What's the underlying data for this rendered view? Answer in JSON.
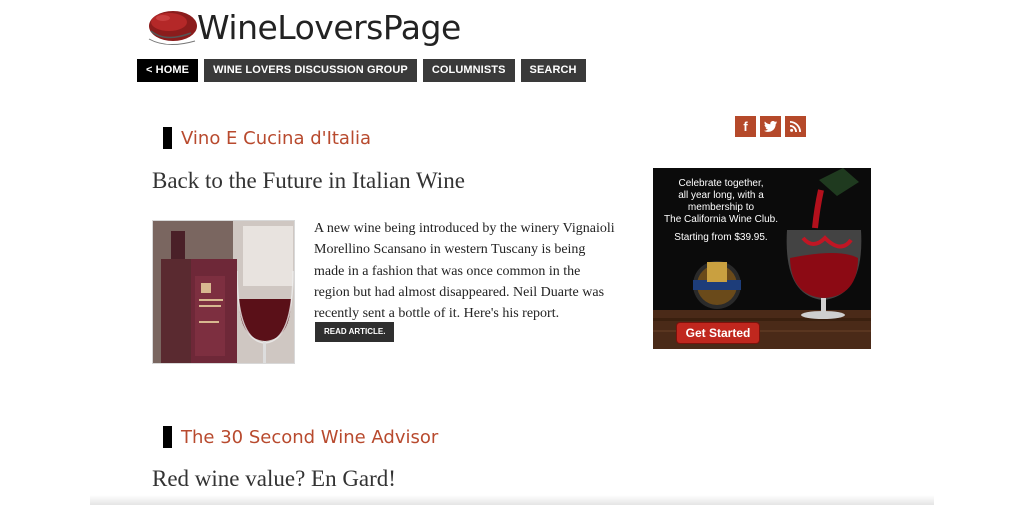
{
  "header": {
    "logo_text": "WineLoversPage"
  },
  "nav": [
    {
      "label": "< HOME"
    },
    {
      "label": "WINE LOVERS DISCUSSION GROUP"
    },
    {
      "label": "COLUMNISTS"
    },
    {
      "label": "SEARCH"
    }
  ],
  "social": {
    "icons": [
      "facebook-icon",
      "twitter-icon",
      "rss-icon"
    ],
    "facebook_glyph": "f",
    "accent": "#b5492a"
  },
  "articles": [
    {
      "section": "Vino E Cucina d'Italia",
      "title": "Back to the Future in Italian Wine",
      "summary": "A new wine being introduced by the winery Vignaioli Morellino Scansano in western Tuscany is being made in a fashion that was once common in the region but had almost disappeared. Neil Duarte was recently sent a bottle of it. Here's his report.",
      "read_more": "READ ARTICLE."
    },
    {
      "section": "The 30 Second Wine Advisor",
      "title": "Red wine value? En Gard!"
    }
  ],
  "ad": {
    "line1": "Celebrate together,",
    "line2": "all year long, with a",
    "line3": "membership to",
    "line4": "The California Wine Club.",
    "price": "Starting from $39.95.",
    "cta": "Get Started"
  },
  "colors": {
    "section_title": "#b84a2e",
    "nav_bg": "#3a3a3a",
    "nav_home_bg": "#000000"
  }
}
